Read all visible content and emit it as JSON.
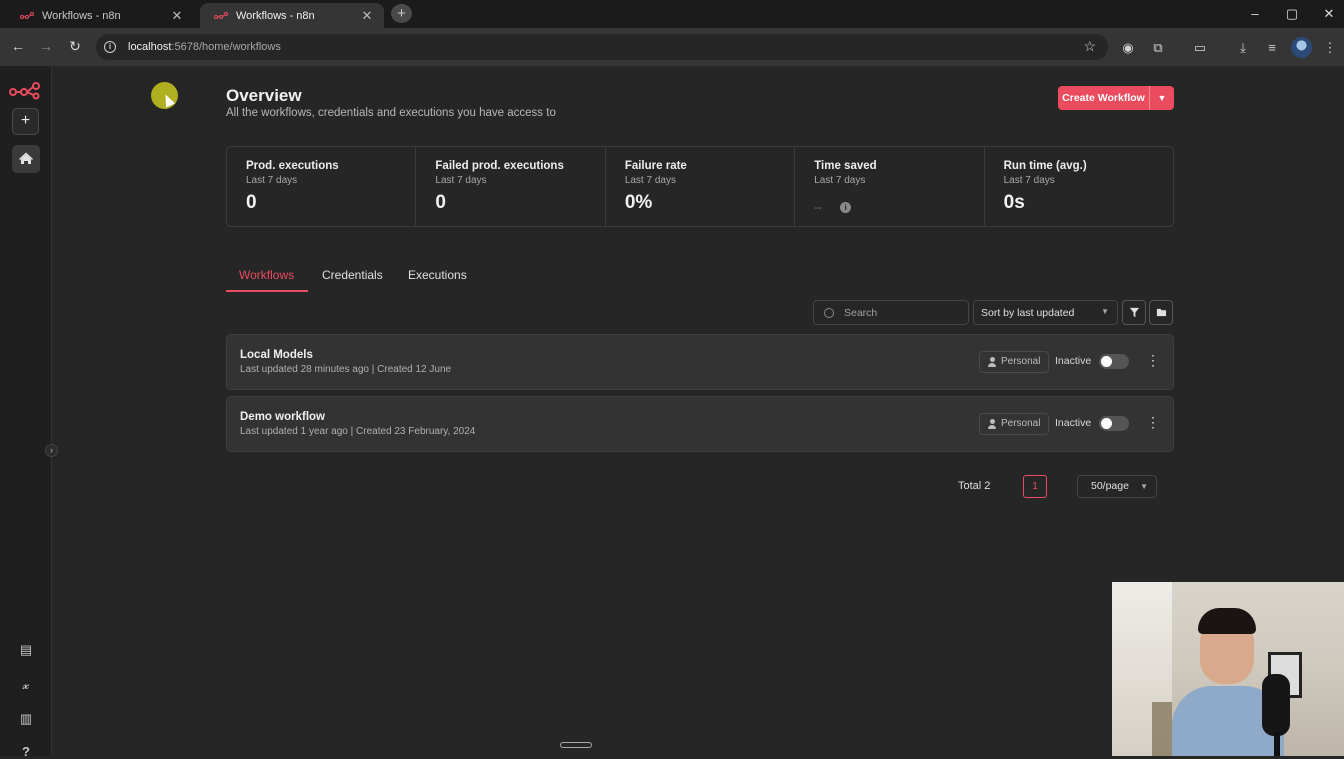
{
  "browser": {
    "tabs": [
      {
        "title": "Workflows - n8n",
        "active": false
      },
      {
        "title": "Workflows - n8n",
        "active": true
      }
    ],
    "url_host": "localhost",
    "url_path": ":5678/home/workflows",
    "newtab_glyph": "+",
    "close_glyph": "✕"
  },
  "sidebar": {
    "add_glyph": "+",
    "collapse_glyph": "›"
  },
  "header": {
    "title": "Overview",
    "subtitle": "All the workflows, credentials and executions you have access to",
    "create_button": "Create Workflow"
  },
  "stats": [
    {
      "label": "Prod. executions",
      "period": "Last 7 days",
      "value": "0"
    },
    {
      "label": "Failed prod. executions",
      "period": "Last 7 days",
      "value": "0"
    },
    {
      "label": "Failure rate",
      "period": "Last 7 days",
      "value": "0%"
    },
    {
      "label": "Time saved",
      "period": "Last 7 days",
      "value": "--"
    },
    {
      "label": "Run time (avg.)",
      "period": "Last 7 days",
      "value": "0s"
    }
  ],
  "tabs": [
    "Workflows",
    "Credentials",
    "Executions"
  ],
  "filters": {
    "search_placeholder": "Search",
    "sort_label": "Sort by last updated"
  },
  "workflows": [
    {
      "name": "Local Models",
      "meta": "Last updated 28 minutes ago | Created 12 June",
      "owner": "Personal",
      "status": "Inactive",
      "active": false
    },
    {
      "name": "Demo workflow",
      "meta": "Last updated 1 year ago | Created 23 February, 2024",
      "owner": "Personal",
      "status": "Inactive",
      "active": false
    }
  ],
  "pagination": {
    "total": "Total 2",
    "current_page": "1",
    "per_page": "50/page"
  },
  "colors": {
    "accent": "#ea4b5f",
    "background": "#262626",
    "sidebar": "#1f1f1f",
    "card": "#333333"
  }
}
